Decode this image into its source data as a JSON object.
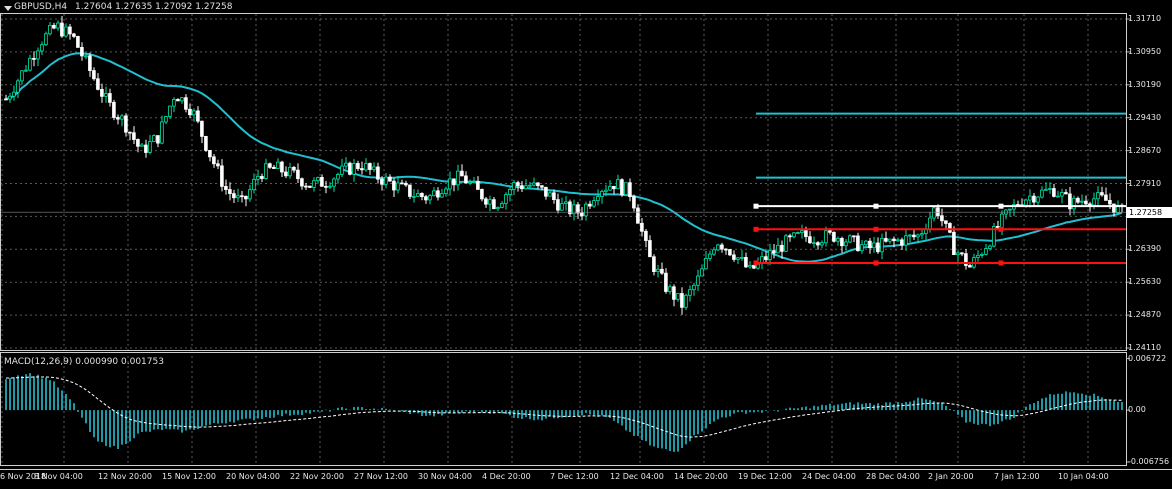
{
  "header": {
    "symbol": "GBPUSD,H4",
    "ohlc": "1.27604 1.27635 1.27092 1.27258",
    "macd_label": "MACD(12,26,9) 0.000990 0.001753"
  },
  "price_axis": {
    "labels": [
      "1.31710",
      "1.30950",
      "1.30190",
      "1.29430",
      "1.28670",
      "1.27910",
      "1.27150",
      "1.26390",
      "1.25630",
      "1.24870",
      "1.24110"
    ],
    "current_price": "1.27258",
    "range": [
      1.2398,
      1.3197
    ]
  },
  "macd_axis": {
    "labels": [
      "0.006722",
      "0.00",
      "-0.006756"
    ],
    "range": [
      -0.00715,
      0.00705
    ]
  },
  "time_axis": {
    "labels": [
      "6 Nov 2018",
      "8 Nov 04:00",
      "12 Nov 20:00",
      "15 Nov 12:00",
      "20 Nov 04:00",
      "22 Nov 20:00",
      "27 Nov 12:00",
      "30 Nov 04:00",
      "4 Dec 20:00",
      "7 Dec 12:00",
      "12 Dec 04:00",
      "14 Dec 20:00",
      "19 Dec 12:00",
      "24 Dec 04:00",
      "28 Dec 04:00",
      "2 Jan 20:00",
      "7 Jan 12:00",
      "10 Jan 04:00"
    ]
  },
  "colors": {
    "background": "#000000",
    "grid": "#5a5a5a",
    "bull": "#00e5a8",
    "bear": "#ffffff",
    "moving_average": "#20c0d0",
    "macd_hist": "#20c0d0",
    "macd_signal": "#ffffff",
    "level_cyan": "#20c0d0",
    "level_white": "#ffffff",
    "level_red": "#ff1010"
  },
  "chart_data": [
    {
      "type": "line",
      "title": "GBPUSD,H4",
      "xlabel": "",
      "ylabel": "",
      "ylim": [
        1.2398,
        1.3197
      ],
      "grid": true,
      "series": [
        {
          "name": "GBPUSD,H4",
          "values": [
            1.2995,
            1.306,
            1.313,
            1.3168,
            1.314,
            1.306,
            1.2985,
            1.294,
            1.287,
            1.2905,
            1.301,
            1.297,
            1.287,
            1.278,
            1.2745,
            1.282,
            1.283,
            1.2815,
            1.279,
            1.28,
            1.2825,
            1.284,
            1.281,
            1.279,
            1.277,
            1.276,
            1.2795,
            1.281,
            1.277,
            1.2745,
            1.279,
            1.279,
            1.277,
            1.2735,
            1.2725,
            1.278,
            1.2795,
            1.277,
            1.262,
            1.255,
            1.2505,
            1.257,
            1.266,
            1.263,
            1.2585,
            1.262,
            1.265,
            1.267,
            1.2665,
            1.267,
            1.2655,
            1.264,
            1.265,
            1.266,
            1.267,
            1.274,
            1.2645,
            1.2595,
            1.265,
            1.271,
            1.2755,
            1.277,
            1.278,
            1.2745,
            1.276,
            1.2755,
            1.2726
          ]
        }
      ],
      "levels": [
        {
          "price": 1.296,
          "color": "cyan",
          "from_x": 0.0
        },
        {
          "price": 1.2808,
          "color": "cyan",
          "from_x": 0.0
        },
        {
          "price": 1.274,
          "color": "white",
          "from_x": 0.0
        },
        {
          "price": 1.2685,
          "color": "red",
          "from_x": 0.0
        },
        {
          "price": 1.2605,
          "color": "red",
          "from_x": 0.0
        }
      ]
    },
    {
      "type": "bar",
      "title": "MACD(12,26,9) 0.000990 0.001753",
      "ylim": [
        -0.00715,
        0.00705
      ],
      "series": [
        {
          "name": "MACD",
          "values": [
            0.0042,
            0.0048,
            0.004,
            0.001,
            -0.004,
            -0.005,
            -0.003,
            -0.0025,
            -0.0028,
            -0.002,
            -0.0015,
            -0.0012,
            -0.0008,
            -0.0005,
            -0.0003,
            0.0002,
            0.0003,
            0.0001,
            -0.0003,
            -0.0008,
            -0.0004,
            -0.0002,
            -0.0003,
            -0.001,
            -0.0012,
            -0.0008,
            -0.0005,
            -0.001,
            -0.003,
            -0.0048,
            -0.0055,
            -0.003,
            -0.001,
            -0.0003,
            -0.0002,
            0.0001,
            0.0004,
            0.0007,
            0.0009,
            0.0008,
            0.001,
            0.0015,
            0.0008,
            -0.0015,
            -0.002,
            -0.0012,
            0.001,
            0.0022,
            0.0024,
            0.0018,
            0.001
          ]
        }
      ]
    }
  ]
}
